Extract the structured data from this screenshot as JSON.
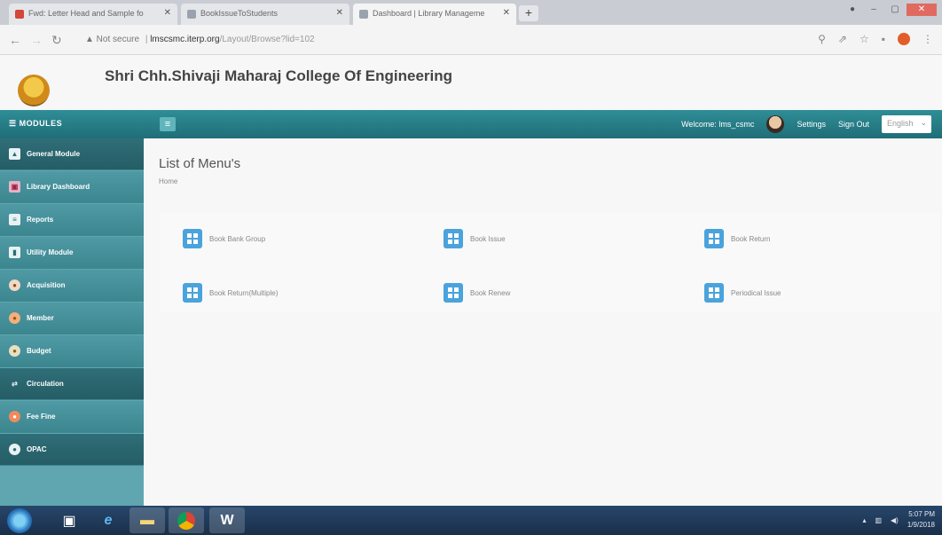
{
  "browser": {
    "tabs": [
      {
        "label": "Fwd: Letter Head and Sample fo",
        "favicon_color": "#d44638"
      },
      {
        "label": "BookIssueToStudents",
        "favicon_color": "#9aa3ad"
      },
      {
        "label": "Dashboard | Library Manageme",
        "favicon_color": "#9aa3ad"
      }
    ],
    "tab_close": "✕",
    "new_tab": "+",
    "address": {
      "security_label": "▲ Not secure",
      "host": "lmscsmc.iterp.org",
      "path": "/Layout/Browse?lid=102"
    }
  },
  "app": {
    "college_name": "Shri Chh.Shivaji Maharaj College Of Engineering",
    "modules_label": "☰ MODULES",
    "hamburger": "≡",
    "welcome": "Welcome: lms_csmc",
    "settings": "Settings",
    "signout": "Sign Out",
    "language": "English"
  },
  "sidebar": {
    "items": [
      {
        "label": "General Module",
        "icon": "▲"
      },
      {
        "label": "Library Dashboard",
        "icon": "▣"
      },
      {
        "label": "Reports",
        "icon": "≡"
      },
      {
        "label": "Utility Module",
        "icon": "▮"
      },
      {
        "label": "Acquisition",
        "icon": "●"
      },
      {
        "label": "Member",
        "icon": "●"
      },
      {
        "label": "Budget",
        "icon": "●"
      },
      {
        "label": "Circulation",
        "icon": "⇄"
      },
      {
        "label": "Fee Fine",
        "icon": "●"
      },
      {
        "label": "OPAC",
        "icon": "●"
      }
    ]
  },
  "main": {
    "title": "List of Menu's",
    "breadcrumb": "Home",
    "menus": [
      {
        "label": "Book Bank Group"
      },
      {
        "label": "Book Issue"
      },
      {
        "label": "Book Return"
      },
      {
        "label": "Book Return(Multiple)"
      },
      {
        "label": "Book Renew"
      },
      {
        "label": "Periodical Issue"
      }
    ]
  },
  "taskbar": {
    "time": "5:07 PM",
    "date": "1/9/2018"
  },
  "colors": {
    "topbar": "#1f6e78",
    "sidebar": "#5fa6b0",
    "menu_icon": "#4aa3dc",
    "taskbar": "#1a2f4a"
  }
}
